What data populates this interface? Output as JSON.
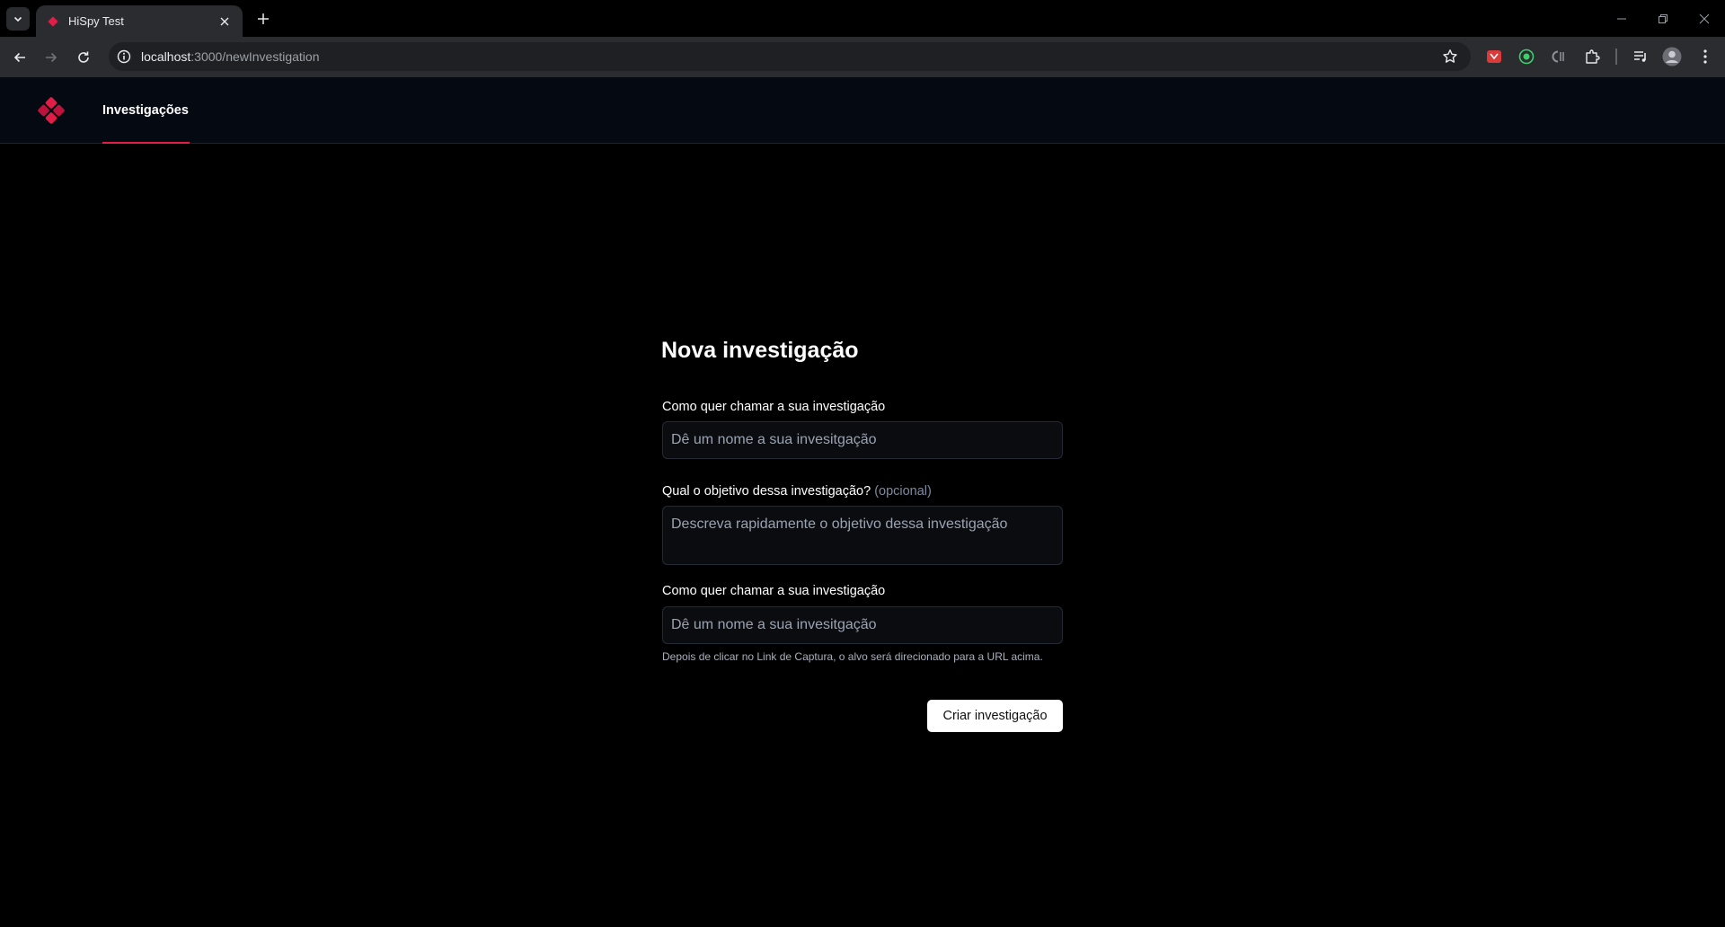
{
  "browser": {
    "tab_title": "HiSpy Test",
    "url_host": "localhost",
    "url_path": ":3000/newInvestigation"
  },
  "header": {
    "nav_investigations": "Investigações",
    "accent_color": "#e11d48"
  },
  "form": {
    "title": "Nova investigação",
    "name_label": "Como quer chamar a sua investigação",
    "name_placeholder": "Dê um nome a sua invesitgação",
    "objective_label": "Qual o objetivo dessa investigação?",
    "objective_optional": "(opcional)",
    "objective_placeholder": "Descreva rapidamente o objetivo dessa investigação",
    "redirect_label": "Como quer chamar a sua investigação",
    "redirect_placeholder": "Dê um nome a sua invesitgação",
    "redirect_hint": "Depois de clicar no Link de Captura, o alvo será direcionado para a URL acima.",
    "submit_label": "Criar investigação"
  }
}
